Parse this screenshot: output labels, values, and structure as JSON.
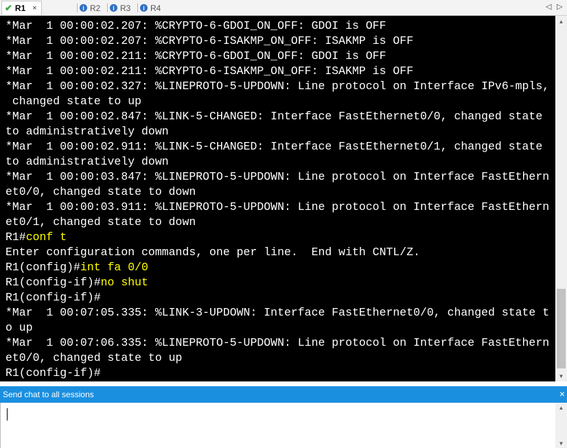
{
  "tabs": [
    {
      "label": "R1",
      "active": true
    },
    {
      "label": "R2",
      "active": false
    },
    {
      "label": "R3",
      "active": false
    },
    {
      "label": "R4",
      "active": false
    }
  ],
  "tab_close": "×",
  "nav": {
    "prev": "◁",
    "next": "▷"
  },
  "terminal": {
    "lines": [
      {
        "text": "*Mar  1 00:00:02.207: %CRYPTO-6-GDOI_ON_OFF: GDOI is OFF"
      },
      {
        "text": "*Mar  1 00:00:02.207: %CRYPTO-6-ISAKMP_ON_OFF: ISAKMP is OFF"
      },
      {
        "text": "*Mar  1 00:00:02.211: %CRYPTO-6-GDOI_ON_OFF: GDOI is OFF"
      },
      {
        "text": "*Mar  1 00:00:02.211: %CRYPTO-6-ISAKMP_ON_OFF: ISAKMP is OFF"
      },
      {
        "text": "*Mar  1 00:00:02.327: %LINEPROTO-5-UPDOWN: Line protocol on Interface IPv6-mpls,"
      },
      {
        "text": " changed state to up"
      },
      {
        "text": "*Mar  1 00:00:02.847: %LINK-5-CHANGED: Interface FastEthernet0/0, changed state"
      },
      {
        "text": "to administratively down"
      },
      {
        "text": "*Mar  1 00:00:02.911: %LINK-5-CHANGED: Interface FastEthernet0/1, changed state"
      },
      {
        "text": "to administratively down"
      },
      {
        "text": "*Mar  1 00:00:03.847: %LINEPROTO-5-UPDOWN: Line protocol on Interface FastEthern"
      },
      {
        "text": "et0/0, changed state to down"
      },
      {
        "text": "*Mar  1 00:00:03.911: %LINEPROTO-5-UPDOWN: Line protocol on Interface FastEthern"
      },
      {
        "text": "et0/1, changed state to down"
      },
      {
        "prompt": "R1#",
        "cmd": "conf t"
      },
      {
        "text": "Enter configuration commands, one per line.  End with CNTL/Z."
      },
      {
        "prompt": "R1(config)#",
        "cmd": "int fa 0/0"
      },
      {
        "prompt": "R1(config-if)#",
        "cmd": "no shut"
      },
      {
        "prompt": "R1(config-if)#",
        "cmd": ""
      },
      {
        "text": "*Mar  1 00:07:05.335: %LINK-3-UPDOWN: Interface FastEthernet0/0, changed state t"
      },
      {
        "text": "o up"
      },
      {
        "text": "*Mar  1 00:07:06.335: %LINEPROTO-5-UPDOWN: Line protocol on Interface FastEthern"
      },
      {
        "text": "et0/0, changed state to up"
      },
      {
        "prompt": "R1(config-if)#",
        "cmd": ""
      }
    ]
  },
  "chat": {
    "header": "Send chat to all sessions",
    "close": "×",
    "value": ""
  },
  "colors": {
    "terminal_bg": "#000000",
    "terminal_text": "#ffffff",
    "command_text": "#ffff00",
    "chat_header_bg": "#1a8fe0"
  }
}
